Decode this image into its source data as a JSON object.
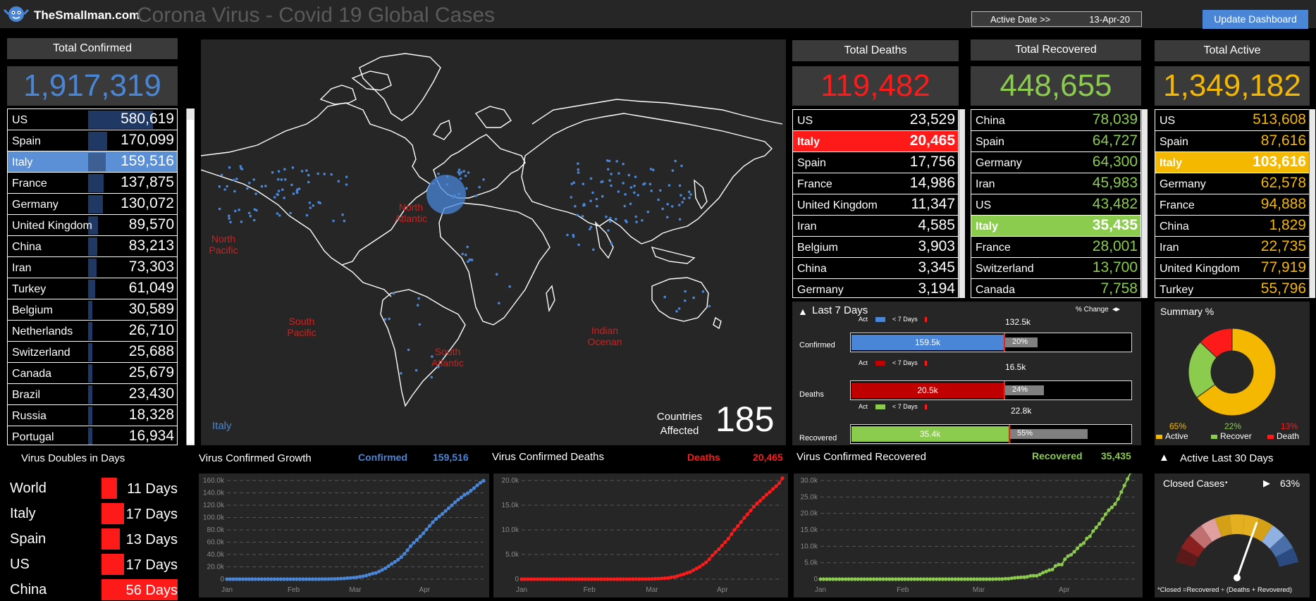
{
  "header": {
    "logo_text": "TheSmallman.com",
    "title": "Corona Virus - Covid 19 Global Cases",
    "active_date_label": "Active Date >>",
    "active_date": "13-Apr-20",
    "update_button": "Update Dashboard"
  },
  "confirmed": {
    "title": "Total Confirmed",
    "total": "1,917,319",
    "max": 580619,
    "rows": [
      {
        "name": "US",
        "value": "580,619",
        "n": 580619
      },
      {
        "name": "Spain",
        "value": "170,099",
        "n": 170099
      },
      {
        "name": "Italy",
        "value": "159,516",
        "n": 159516,
        "highlight": true
      },
      {
        "name": "France",
        "value": "137,875",
        "n": 137875
      },
      {
        "name": "Germany",
        "value": "130,072",
        "n": 130072
      },
      {
        "name": "United Kingdom",
        "value": "89,570",
        "n": 89570
      },
      {
        "name": "China",
        "value": "83,213",
        "n": 83213
      },
      {
        "name": "Iran",
        "value": "73,303",
        "n": 73303
      },
      {
        "name": "Turkey",
        "value": "61,049",
        "n": 61049
      },
      {
        "name": "Belgium",
        "value": "30,589",
        "n": 30589
      },
      {
        "name": "Netherlands",
        "value": "26,710",
        "n": 26710
      },
      {
        "name": "Switzerland",
        "value": "25,688",
        "n": 25688
      },
      {
        "name": "Canada",
        "value": "25,679",
        "n": 25679
      },
      {
        "name": "Brazil",
        "value": "23,430",
        "n": 23430
      },
      {
        "name": "Russia",
        "value": "18,328",
        "n": 18328
      },
      {
        "name": "Portugal",
        "value": "16,934",
        "n": 16934
      }
    ]
  },
  "map": {
    "labels": [
      "North Pacific",
      "North Atlantic",
      "South Pacific",
      "South Atlantic",
      "Indian Ocenan"
    ],
    "selected_country": "Italy",
    "countries_label_1": "Countries",
    "countries_label_2": "Affected",
    "countries_count": "185"
  },
  "deaths": {
    "title": "Total Deaths",
    "total": "119,482",
    "color": "#ff1a1a",
    "rows": [
      {
        "name": "US",
        "value": "23,529"
      },
      {
        "name": "Italy",
        "value": "20,465",
        "highlight": true
      },
      {
        "name": "Spain",
        "value": "17,756"
      },
      {
        "name": "France",
        "value": "14,986"
      },
      {
        "name": "United Kingdom",
        "value": "11,347"
      },
      {
        "name": "Iran",
        "value": "4,585"
      },
      {
        "name": "Belgium",
        "value": "3,903"
      },
      {
        "name": "China",
        "value": "3,345"
      },
      {
        "name": "Germany",
        "value": "3,194"
      }
    ]
  },
  "recovered": {
    "title": "Total Recovered",
    "total": "448,655",
    "color": "#8bcb4d",
    "rows": [
      {
        "name": "China",
        "value": "78,039"
      },
      {
        "name": "Spain",
        "value": "64,727"
      },
      {
        "name": "Germany",
        "value": "64,300"
      },
      {
        "name": "Iran",
        "value": "45,983"
      },
      {
        "name": "US",
        "value": "43,482"
      },
      {
        "name": "Italy",
        "value": "35,435",
        "highlight": true
      },
      {
        "name": "France",
        "value": "28,001"
      },
      {
        "name": "Switzerland",
        "value": "13,700"
      },
      {
        "name": "Canada",
        "value": "7,758"
      }
    ]
  },
  "active": {
    "title": "Total Active",
    "total": "1,349,182",
    "color": "#f5b800",
    "rows": [
      {
        "name": "US",
        "value": "513,608"
      },
      {
        "name": "Spain",
        "value": "87,616"
      },
      {
        "name": "Italy",
        "value": "103,616",
        "highlight": true
      },
      {
        "name": "Germany",
        "value": "62,578"
      },
      {
        "name": "France",
        "value": "94,888"
      },
      {
        "name": "China",
        "value": "1,829"
      },
      {
        "name": "Iran",
        "value": "22,735"
      },
      {
        "name": "United Kingdom",
        "value": "77,919"
      },
      {
        "name": "Turkey",
        "value": "55,796"
      }
    ]
  },
  "last7": {
    "title": "Last 7 Days",
    "pct_change_label": "% Change",
    "legend_act": "Act",
    "legend_prev": "< 7 Days",
    "rows": [
      {
        "label": "Confirmed",
        "act": "159.5k",
        "prev": "132.5k",
        "pct": "20%",
        "act_frac": 0.66,
        "prev_frac": 0.55,
        "color": "#4a86d8"
      },
      {
        "label": "Deaths",
        "act": "20.5k",
        "prev": "16.5k",
        "pct": "24%",
        "act_frac": 0.68,
        "prev_frac": 0.55,
        "color": "#c00000"
      },
      {
        "label": "Recovered",
        "act": "35.4k",
        "prev": "22.8k",
        "pct": "55%",
        "act_frac": 0.88,
        "prev_frac": 0.57,
        "color": "#8bcb4d"
      }
    ]
  },
  "summary": {
    "title": "Summary %",
    "slices": [
      {
        "label": "Active",
        "pct": "65%",
        "value": 65,
        "color": "#f5b800"
      },
      {
        "label": "Recover",
        "pct": "22%",
        "value": 22,
        "color": "#8bcb4d"
      },
      {
        "label": "Death",
        "pct": "13%",
        "value": 13,
        "color": "#ff1a1a"
      }
    ]
  },
  "doubles": {
    "title": "Virus Doubles in Days",
    "rows": [
      {
        "name": "World",
        "days": "11 Days",
        "frac": 0.2
      },
      {
        "name": "Italy",
        "days": "17 Days",
        "frac": 0.3
      },
      {
        "name": "Spain",
        "days": "13 Days",
        "frac": 0.24
      },
      {
        "name": "US",
        "days": "17 Days",
        "frac": 0.3
      },
      {
        "name": "China",
        "days": "56 Days",
        "frac": 1.0
      }
    ]
  },
  "growth_charts": [
    {
      "title": "Virus Confirmed Growth",
      "series_label": "Confirmed",
      "series_value": "159,516",
      "color": "#4a86d8"
    },
    {
      "title": "Virus Confirmed Deaths",
      "series_label": "Deaths",
      "series_value": "20,465",
      "color": "#ff1a1a"
    },
    {
      "title": "Virus Confirmed Recovered",
      "series_label": "Recovered",
      "series_value": "35,435",
      "color": "#8bcb4d"
    }
  ],
  "active30": {
    "title": "Active Last 30 Days"
  },
  "closed": {
    "title": "Closed Cases",
    "pct": "63%",
    "value": 63,
    "footnote": "*Closed =Recovered ÷ (Deaths + Revovered)"
  },
  "chart_data": [
    {
      "type": "line",
      "title": "Virus Confirmed Growth",
      "x_ticks": [
        "Jan",
        "Feb",
        "Mar",
        "Apr"
      ],
      "y_ticks": [
        "0",
        "20.0k",
        "40.0k",
        "60.0k",
        "80.0k",
        "100.0k",
        "120.0k",
        "140.0k",
        "160.0k"
      ],
      "ylim": [
        0,
        160000
      ],
      "series": [
        {
          "name": "Confirmed",
          "values": [
            0,
            0,
            0,
            0,
            0,
            0,
            0,
            0,
            0,
            0,
            0,
            0,
            0,
            0,
            0,
            0,
            0,
            0,
            0,
            0,
            0,
            0,
            0,
            0,
            0,
            0,
            0,
            0,
            3,
            20,
            62,
            155,
            229,
            322,
            453,
            655,
            888,
            1128,
            1694,
            2036,
            2502,
            3089,
            3858,
            4636,
            5883,
            7375,
            9172,
            10149,
            12462,
            15113,
            17660,
            21157,
            24747,
            27980,
            31506,
            35713,
            41035,
            47021,
            53578,
            59138,
            63927,
            69176,
            74386,
            80589,
            86498,
            92472,
            97689,
            101739,
            105792,
            110574,
            115242,
            119827,
            124632,
            128948,
            132547,
            136816,
            139422,
            143626,
            147577,
            152271,
            156363,
            159516
          ]
        }
      ],
      "grid": true
    },
    {
      "type": "line",
      "title": "Virus Confirmed Deaths",
      "x_ticks": [
        "Jan",
        "Feb",
        "Mar",
        "Apr"
      ],
      "y_ticks": [
        "0",
        "5.0k",
        "10.0k",
        "15.0k",
        "20.0k"
      ],
      "ylim": [
        0,
        20000
      ],
      "series": [
        {
          "name": "Deaths",
          "values": [
            0,
            0,
            0,
            0,
            0,
            0,
            0,
            0,
            0,
            0,
            0,
            0,
            0,
            0,
            0,
            0,
            0,
            0,
            0,
            0,
            0,
            0,
            0,
            0,
            0,
            0,
            0,
            0,
            0,
            0,
            0,
            1,
            2,
            3,
            7,
            10,
            12,
            17,
            21,
            29,
            34,
            52,
            79,
            107,
            148,
            197,
            233,
            366,
            463,
            631,
            827,
            1016,
            1266,
            1441,
            1809,
            2158,
            2503,
            2978,
            3405,
            4032,
            4825,
            5476,
            6077,
            6820,
            7503,
            8215,
            9134,
            10023,
            10779,
            11591,
            12428,
            13155,
            13915,
            14681,
            15362,
            15887,
            16523,
            17127,
            17669,
            18279,
            18849,
            19468,
            20465
          ]
        }
      ],
      "grid": true
    },
    {
      "type": "line",
      "title": "Virus Confirmed Recovered",
      "x_ticks": [
        "Jan",
        "Feb",
        "Mar",
        "Apr"
      ],
      "y_ticks": [
        "0",
        "5.0k",
        "10.0k",
        "15.0k",
        "20.0k",
        "25.0k",
        "30.0k"
      ],
      "ylim": [
        0,
        30000
      ],
      "series": [
        {
          "name": "Recovered",
          "values": [
            0,
            0,
            0,
            0,
            0,
            0,
            0,
            0,
            0,
            0,
            0,
            0,
            0,
            0,
            0,
            0,
            0,
            0,
            0,
            0,
            0,
            0,
            0,
            0,
            0,
            0,
            0,
            0,
            0,
            0,
            0,
            0,
            0,
            0,
            0,
            0,
            0,
            0,
            0,
            0,
            0,
            0,
            0,
            0,
            0,
            0,
            0,
            0,
            0,
            0,
            0,
            1,
            2,
            1,
            1,
            4,
            46,
            46,
            46,
            149,
            160,
            276,
            414,
            523,
            589,
            622,
            724,
            1004,
            1045,
            1045,
            1439,
            1966,
            2335,
            2749,
            2941,
            4025,
            4440,
            4440,
            6072,
            7024,
            7432,
            8326,
            9362,
            10361,
            10950,
            12384,
            13030,
            14620,
            15729,
            16847,
            18278,
            19758,
            20996,
            21815,
            22837,
            24392,
            26491,
            28470,
            30455,
            32534,
            34211,
            35435
          ]
        }
      ],
      "grid": true
    }
  ]
}
